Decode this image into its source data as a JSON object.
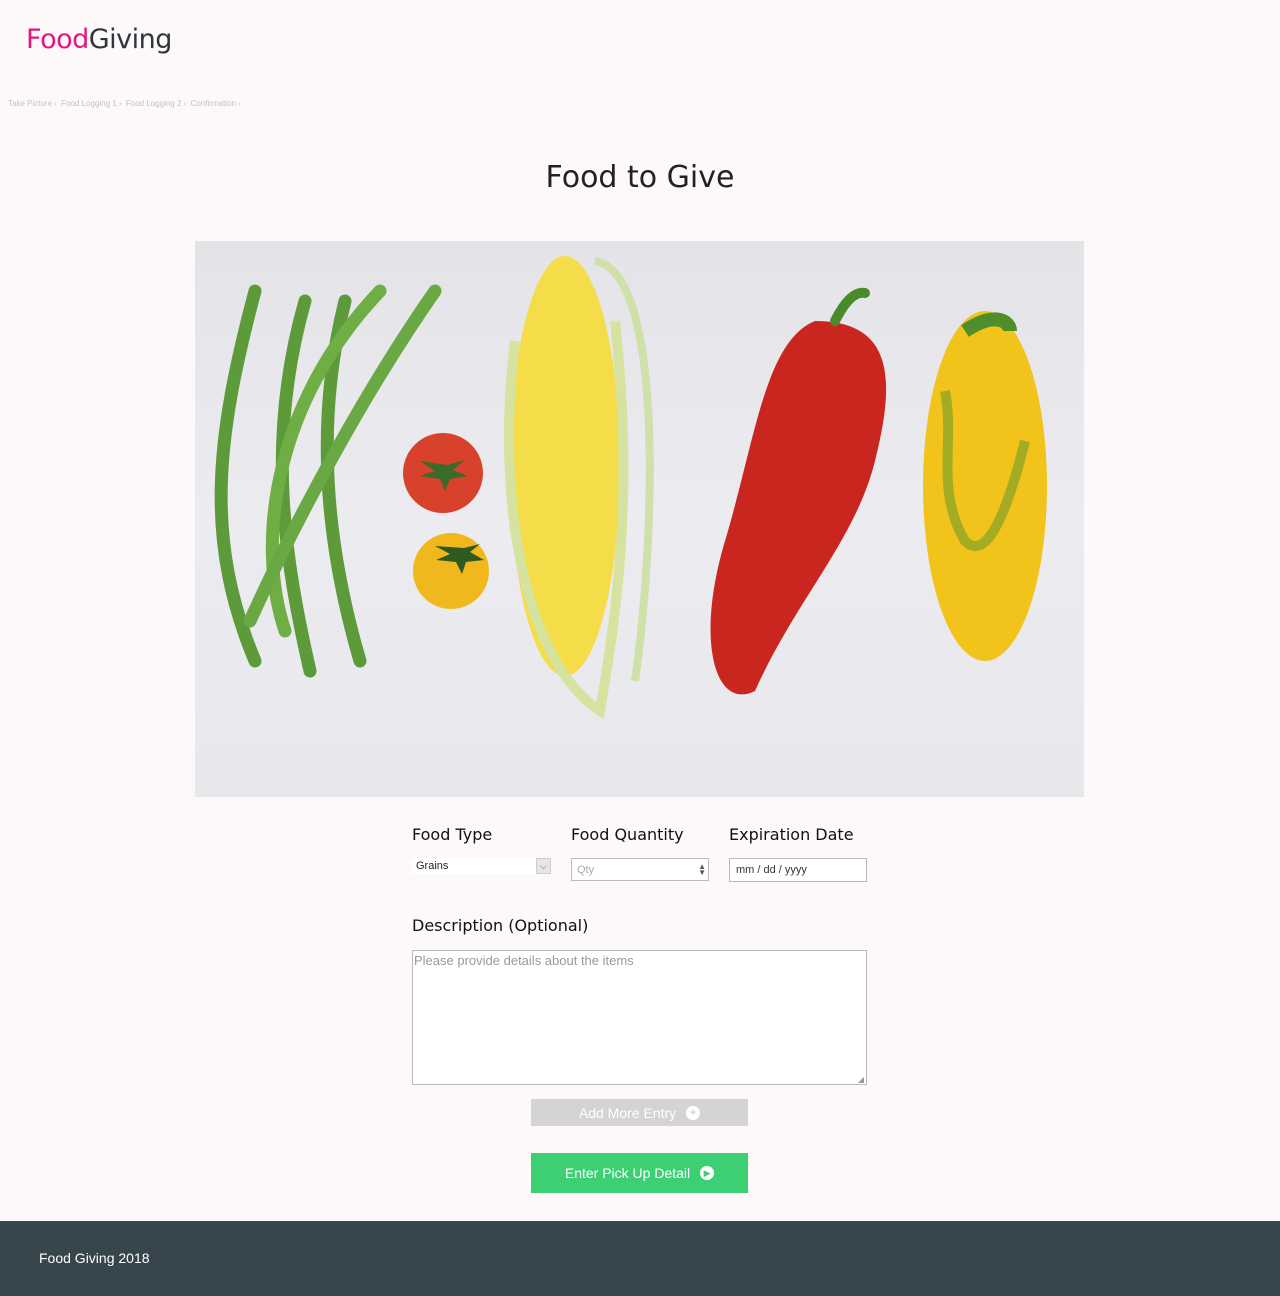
{
  "brand": {
    "part1": "Food",
    "part2": "Giving",
    "color_primary": "#e3187e",
    "color_secondary": "#2e3640"
  },
  "breadcrumb": [
    "Take Picture ›",
    "Food Logging 1 ›",
    "Food Logging 2 ›",
    "Confirmation ›"
  ],
  "page_title": "Food to Give",
  "hero_image": {
    "icon": "vegetables-photo"
  },
  "form": {
    "food_type": {
      "label": "Food Type",
      "value": "Grains"
    },
    "food_quantity": {
      "label": "Food Quantity",
      "placeholder": "Qty"
    },
    "expiration_date": {
      "label": "Expiration Date",
      "placeholder": "mm / dd / yyyy"
    },
    "description": {
      "label": "Description (Optional)",
      "placeholder": "Please provide details about the items"
    }
  },
  "buttons": {
    "add_more": "Add More Entry",
    "enter_pickup": "Enter Pick Up Detail"
  },
  "colors": {
    "accent_green": "#3ccf73",
    "disabled_gray": "#d4d4d4",
    "footer_bg": "#37454d"
  },
  "footer": {
    "text": "Food Giving 2018"
  }
}
